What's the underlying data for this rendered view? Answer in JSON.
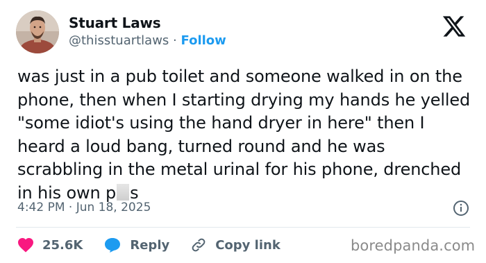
{
  "author": {
    "display_name": "Stuart Laws",
    "handle": "@thisstuartlaws",
    "separator": "·",
    "follow_label": "Follow",
    "avatar_icon": "profile-photo"
  },
  "brand": {
    "logo_icon": "x-logo-icon"
  },
  "tweet": {
    "text_part1": "was just in a pub toilet and someone walked in on the phone, then when I starting drying my hands he yelled \"some idiot's using the hand dryer in here\" then I heard a loud bang, turned round and he was scrabbling in the metal urinal for his phone, drenched in his own p",
    "text_part2": "s",
    "timestamp": "4:42 PM · Jun 18, 2025"
  },
  "actions": {
    "likes_count": "25.6K",
    "reply_label": "Reply",
    "copy_link_label": "Copy link"
  },
  "watermark": "boredpanda.com",
  "colors": {
    "like": "#f91880",
    "reply": "#1d9bf0",
    "follow": "#1d9bf0",
    "muted": "#536471"
  }
}
